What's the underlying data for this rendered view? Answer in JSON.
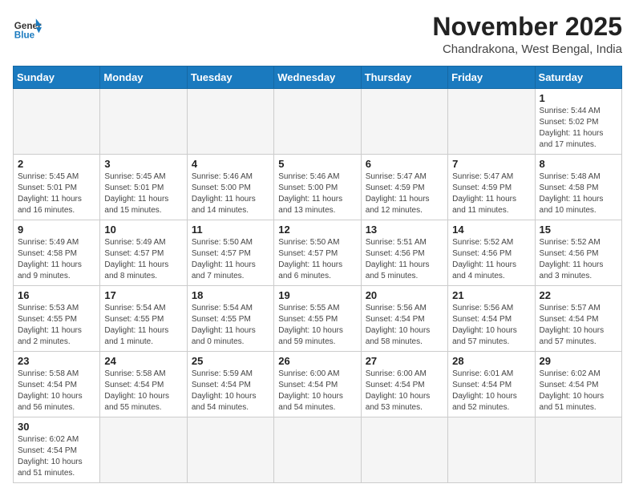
{
  "header": {
    "logo_general": "General",
    "logo_blue": "Blue",
    "month_title": "November 2025",
    "location": "Chandrakona, West Bengal, India"
  },
  "weekdays": [
    "Sunday",
    "Monday",
    "Tuesday",
    "Wednesday",
    "Thursday",
    "Friday",
    "Saturday"
  ],
  "weeks": [
    [
      {
        "day": "",
        "info": ""
      },
      {
        "day": "",
        "info": ""
      },
      {
        "day": "",
        "info": ""
      },
      {
        "day": "",
        "info": ""
      },
      {
        "day": "",
        "info": ""
      },
      {
        "day": "",
        "info": ""
      },
      {
        "day": "1",
        "info": "Sunrise: 5:44 AM\nSunset: 5:02 PM\nDaylight: 11 hours\nand 17 minutes."
      }
    ],
    [
      {
        "day": "2",
        "info": "Sunrise: 5:45 AM\nSunset: 5:01 PM\nDaylight: 11 hours\nand 16 minutes."
      },
      {
        "day": "3",
        "info": "Sunrise: 5:45 AM\nSunset: 5:01 PM\nDaylight: 11 hours\nand 15 minutes."
      },
      {
        "day": "4",
        "info": "Sunrise: 5:46 AM\nSunset: 5:00 PM\nDaylight: 11 hours\nand 14 minutes."
      },
      {
        "day": "5",
        "info": "Sunrise: 5:46 AM\nSunset: 5:00 PM\nDaylight: 11 hours\nand 13 minutes."
      },
      {
        "day": "6",
        "info": "Sunrise: 5:47 AM\nSunset: 4:59 PM\nDaylight: 11 hours\nand 12 minutes."
      },
      {
        "day": "7",
        "info": "Sunrise: 5:47 AM\nSunset: 4:59 PM\nDaylight: 11 hours\nand 11 minutes."
      },
      {
        "day": "8",
        "info": "Sunrise: 5:48 AM\nSunset: 4:58 PM\nDaylight: 11 hours\nand 10 minutes."
      }
    ],
    [
      {
        "day": "9",
        "info": "Sunrise: 5:49 AM\nSunset: 4:58 PM\nDaylight: 11 hours\nand 9 minutes."
      },
      {
        "day": "10",
        "info": "Sunrise: 5:49 AM\nSunset: 4:57 PM\nDaylight: 11 hours\nand 8 minutes."
      },
      {
        "day": "11",
        "info": "Sunrise: 5:50 AM\nSunset: 4:57 PM\nDaylight: 11 hours\nand 7 minutes."
      },
      {
        "day": "12",
        "info": "Sunrise: 5:50 AM\nSunset: 4:57 PM\nDaylight: 11 hours\nand 6 minutes."
      },
      {
        "day": "13",
        "info": "Sunrise: 5:51 AM\nSunset: 4:56 PM\nDaylight: 11 hours\nand 5 minutes."
      },
      {
        "day": "14",
        "info": "Sunrise: 5:52 AM\nSunset: 4:56 PM\nDaylight: 11 hours\nand 4 minutes."
      },
      {
        "day": "15",
        "info": "Sunrise: 5:52 AM\nSunset: 4:56 PM\nDaylight: 11 hours\nand 3 minutes."
      }
    ],
    [
      {
        "day": "16",
        "info": "Sunrise: 5:53 AM\nSunset: 4:55 PM\nDaylight: 11 hours\nand 2 minutes."
      },
      {
        "day": "17",
        "info": "Sunrise: 5:54 AM\nSunset: 4:55 PM\nDaylight: 11 hours\nand 1 minute."
      },
      {
        "day": "18",
        "info": "Sunrise: 5:54 AM\nSunset: 4:55 PM\nDaylight: 11 hours\nand 0 minutes."
      },
      {
        "day": "19",
        "info": "Sunrise: 5:55 AM\nSunset: 4:55 PM\nDaylight: 10 hours\nand 59 minutes."
      },
      {
        "day": "20",
        "info": "Sunrise: 5:56 AM\nSunset: 4:54 PM\nDaylight: 10 hours\nand 58 minutes."
      },
      {
        "day": "21",
        "info": "Sunrise: 5:56 AM\nSunset: 4:54 PM\nDaylight: 10 hours\nand 57 minutes."
      },
      {
        "day": "22",
        "info": "Sunrise: 5:57 AM\nSunset: 4:54 PM\nDaylight: 10 hours\nand 57 minutes."
      }
    ],
    [
      {
        "day": "23",
        "info": "Sunrise: 5:58 AM\nSunset: 4:54 PM\nDaylight: 10 hours\nand 56 minutes."
      },
      {
        "day": "24",
        "info": "Sunrise: 5:58 AM\nSunset: 4:54 PM\nDaylight: 10 hours\nand 55 minutes."
      },
      {
        "day": "25",
        "info": "Sunrise: 5:59 AM\nSunset: 4:54 PM\nDaylight: 10 hours\nand 54 minutes."
      },
      {
        "day": "26",
        "info": "Sunrise: 6:00 AM\nSunset: 4:54 PM\nDaylight: 10 hours\nand 54 minutes."
      },
      {
        "day": "27",
        "info": "Sunrise: 6:00 AM\nSunset: 4:54 PM\nDaylight: 10 hours\nand 53 minutes."
      },
      {
        "day": "28",
        "info": "Sunrise: 6:01 AM\nSunset: 4:54 PM\nDaylight: 10 hours\nand 52 minutes."
      },
      {
        "day": "29",
        "info": "Sunrise: 6:02 AM\nSunset: 4:54 PM\nDaylight: 10 hours\nand 51 minutes."
      }
    ],
    [
      {
        "day": "30",
        "info": "Sunrise: 6:02 AM\nSunset: 4:54 PM\nDaylight: 10 hours\nand 51 minutes."
      },
      {
        "day": "",
        "info": ""
      },
      {
        "day": "",
        "info": ""
      },
      {
        "day": "",
        "info": ""
      },
      {
        "day": "",
        "info": ""
      },
      {
        "day": "",
        "info": ""
      },
      {
        "day": "",
        "info": ""
      }
    ]
  ]
}
